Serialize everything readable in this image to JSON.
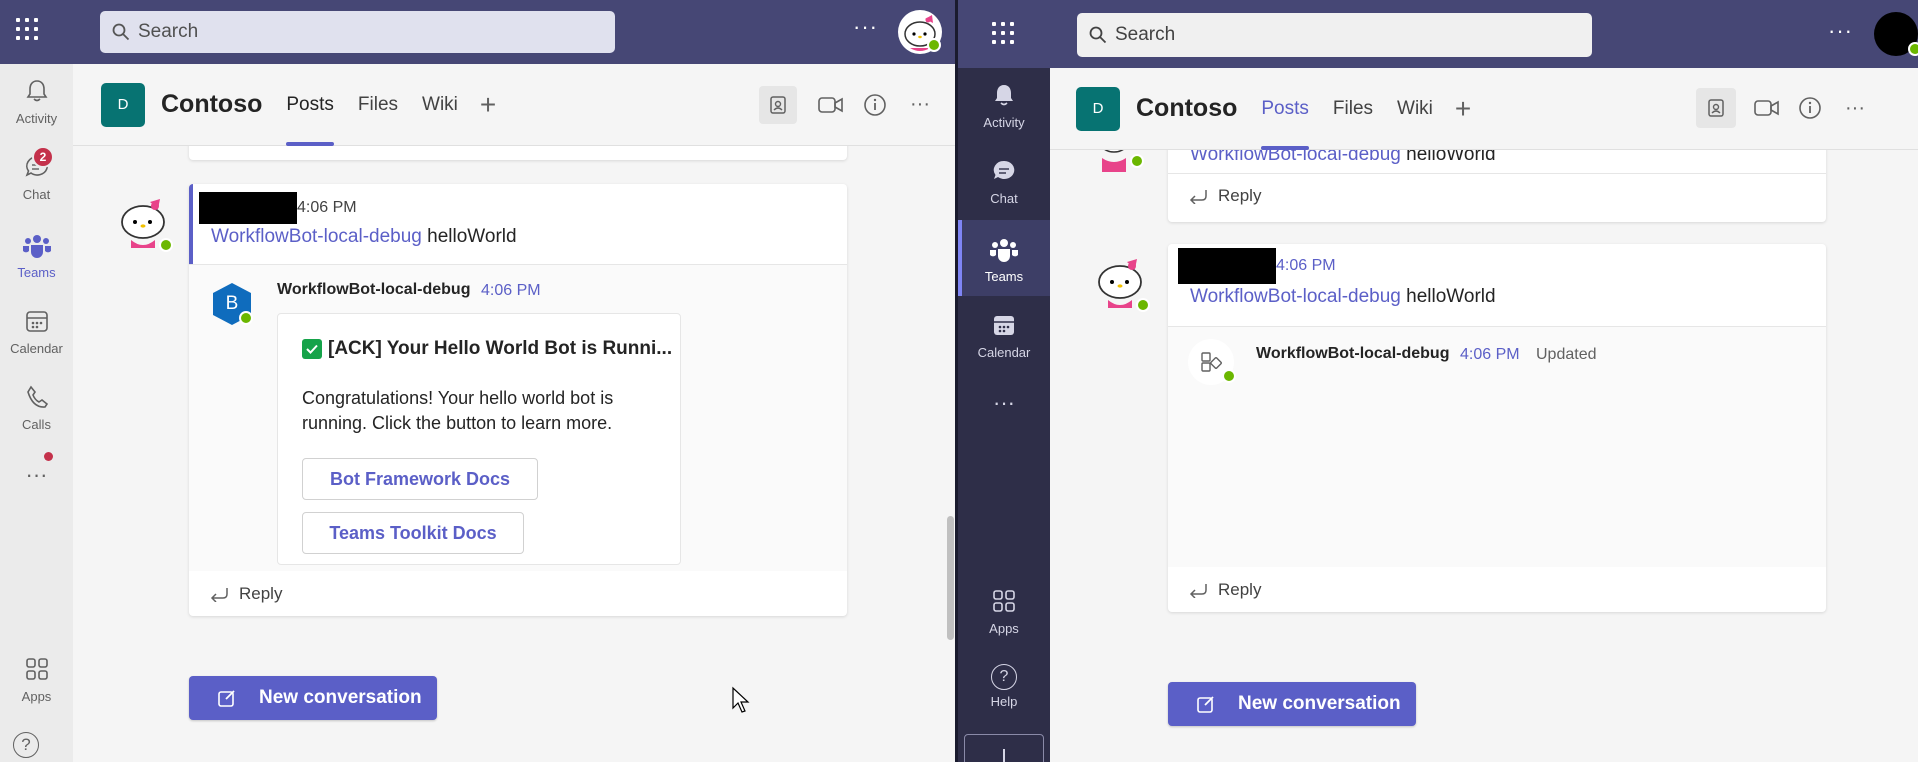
{
  "left": {
    "search_placeholder": "Search",
    "more": "···",
    "rail": {
      "activity": "Activity",
      "chat": "Chat",
      "chat_badge": "2",
      "teams": "Teams",
      "calendar": "Calendar",
      "calls": "Calls",
      "more": "···",
      "apps": "Apps",
      "help": "?"
    },
    "team_icon": "D",
    "team_name": "Contoso",
    "tabs": [
      "Posts",
      "Files",
      "Wiki"
    ],
    "header_more": "···",
    "message": {
      "time": "4:06 PM",
      "mention": "WorkflowBot-local-debug",
      "text": "helloWorld"
    },
    "bot_reply": {
      "avatar": "B",
      "sender": "WorkflowBot-local-debug",
      "time": "4:06 PM",
      "card_title": "[ACK] Your Hello World Bot is Runni...",
      "card_text": "Congratulations! Your hello world bot is running. Click the button to learn more.",
      "buttons": [
        "Bot Framework Docs",
        "Teams Toolkit Docs"
      ]
    },
    "reply": "Reply",
    "new_conversation": "New conversation"
  },
  "right": {
    "search_placeholder": "Search",
    "more": "···",
    "rail": {
      "activity": "Activity",
      "chat": "Chat",
      "teams": "Teams",
      "calendar": "Calendar",
      "more": "···",
      "apps": "Apps",
      "help": "Help",
      "help_glyph": "?"
    },
    "team_icon": "D",
    "team_name": "Contoso",
    "tabs": [
      "Posts",
      "Files",
      "Wiki"
    ],
    "header_more": "···",
    "prev_message": {
      "mention": "WorkflowBot-local-debug",
      "text": "helloWorld"
    },
    "prev_reply": "Reply",
    "message": {
      "time": "4:06 PM",
      "mention": "WorkflowBot-local-debug",
      "text": "helloWorld"
    },
    "bot_reply": {
      "sender": "WorkflowBot-local-debug",
      "time": "4:06 PM",
      "status": "Updated"
    },
    "reply": "Reply",
    "new_conversation": "New conversation"
  },
  "colors": {
    "header": "#464775",
    "accent": "#5b5fc7",
    "team_icon": "#077372",
    "presence": "#6bb700",
    "badge": "#c4314b",
    "dark_rail": "#2e2e48"
  }
}
